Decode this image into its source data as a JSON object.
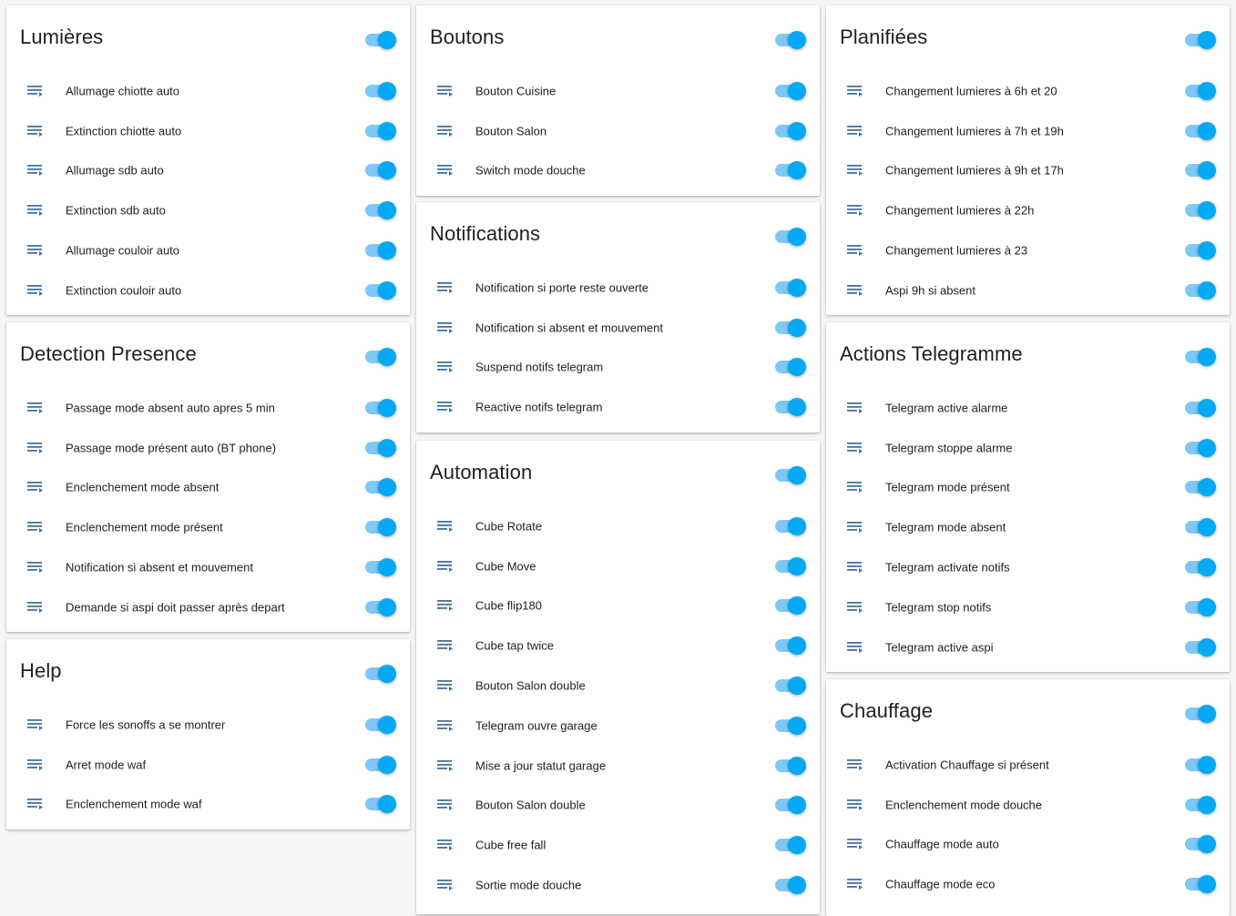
{
  "theme": {
    "accent": "#03a9f4",
    "track": "#7ec8f7",
    "icon_color": "#44739e"
  },
  "columns": [
    {
      "cards": [
        {
          "title": "Lumières",
          "enabled": true,
          "items": [
            {
              "label": "Allumage chiotte auto",
              "icon": "script-text-icon",
              "enabled": true
            },
            {
              "label": "Extinction chiotte auto",
              "icon": "script-text-icon",
              "enabled": true
            },
            {
              "label": "Allumage sdb auto",
              "icon": "script-text-icon",
              "enabled": true
            },
            {
              "label": "Extinction sdb auto",
              "icon": "script-text-icon",
              "enabled": true
            },
            {
              "label": "Allumage couloir auto",
              "icon": "script-text-icon",
              "enabled": true
            },
            {
              "label": "Extinction couloir auto",
              "icon": "script-text-icon",
              "enabled": true
            }
          ]
        },
        {
          "title": "Detection Presence",
          "enabled": true,
          "items": [
            {
              "label": "Passage mode absent auto apres 5 min",
              "icon": "script-text-icon",
              "enabled": true
            },
            {
              "label": "Passage mode présent auto (BT phone)",
              "icon": "script-text-icon",
              "enabled": true
            },
            {
              "label": "Enclenchement mode absent",
              "icon": "script-text-icon",
              "enabled": true
            },
            {
              "label": "Enclenchement mode présent",
              "icon": "script-text-icon",
              "enabled": true
            },
            {
              "label": "Notification si absent et mouvement",
              "icon": "script-text-icon",
              "enabled": true
            },
            {
              "label": "Demande si aspi doit passer après depart",
              "icon": "script-text-icon",
              "enabled": true
            }
          ]
        },
        {
          "title": "Help",
          "enabled": true,
          "items": [
            {
              "label": "Force les sonoffs a se montrer",
              "icon": "script-text-icon",
              "enabled": true
            },
            {
              "label": "Arret mode waf",
              "icon": "script-text-icon",
              "enabled": true
            },
            {
              "label": "Enclenchement mode waf",
              "icon": "script-text-icon",
              "enabled": true
            }
          ]
        }
      ]
    },
    {
      "cards": [
        {
          "title": "Boutons",
          "enabled": true,
          "items": [
            {
              "label": "Bouton Cuisine",
              "icon": "script-text-icon",
              "enabled": true
            },
            {
              "label": "Bouton Salon",
              "icon": "script-text-icon",
              "enabled": true
            },
            {
              "label": "Switch mode douche",
              "icon": "script-text-icon",
              "enabled": true
            }
          ]
        },
        {
          "title": "Notifications",
          "enabled": true,
          "items": [
            {
              "label": "Notification si porte reste ouverte",
              "icon": "script-text-icon",
              "enabled": true
            },
            {
              "label": "Notification si absent et mouvement",
              "icon": "script-text-icon",
              "enabled": true
            },
            {
              "label": "Suspend notifs telegram",
              "icon": "script-text-icon",
              "enabled": true
            },
            {
              "label": "Reactive notifs telegram",
              "icon": "script-text-icon",
              "enabled": true
            }
          ]
        },
        {
          "title": "Automation",
          "enabled": true,
          "items": [
            {
              "label": "Cube Rotate",
              "icon": "script-text-icon",
              "enabled": true
            },
            {
              "label": "Cube Move",
              "icon": "script-text-icon",
              "enabled": true
            },
            {
              "label": "Cube flip180",
              "icon": "script-text-icon",
              "enabled": true
            },
            {
              "label": "Cube tap twice",
              "icon": "script-text-icon",
              "enabled": true
            },
            {
              "label": "Bouton Salon double",
              "icon": "script-text-icon",
              "enabled": true
            },
            {
              "label": "Telegram ouvre garage",
              "icon": "script-text-icon",
              "enabled": true
            },
            {
              "label": "Mise a jour statut garage",
              "icon": "script-text-icon",
              "enabled": true
            },
            {
              "label": "Bouton Salon double",
              "icon": "script-text-icon",
              "enabled": true
            },
            {
              "label": "Cube free fall",
              "icon": "script-text-icon",
              "enabled": true
            },
            {
              "label": "Sortie mode douche",
              "icon": "script-text-icon",
              "enabled": true
            }
          ]
        }
      ]
    },
    {
      "cards": [
        {
          "title": "Planifiées",
          "enabled": true,
          "items": [
            {
              "label": "Changement lumieres à 6h et 20",
              "icon": "script-text-icon",
              "enabled": true
            },
            {
              "label": "Changement lumieres à 7h et 19h",
              "icon": "script-text-icon",
              "enabled": true
            },
            {
              "label": "Changement lumieres à 9h et 17h",
              "icon": "script-text-icon",
              "enabled": true
            },
            {
              "label": "Changement lumieres à 22h",
              "icon": "script-text-icon",
              "enabled": true
            },
            {
              "label": "Changement lumieres à 23",
              "icon": "script-text-icon",
              "enabled": true
            },
            {
              "label": "Aspi 9h si absent",
              "icon": "script-text-icon",
              "enabled": true
            }
          ]
        },
        {
          "title": "Actions Telegramme",
          "enabled": true,
          "items": [
            {
              "label": "Telegram active alarme",
              "icon": "script-text-icon",
              "enabled": true
            },
            {
              "label": "Telegram stoppe alarme",
              "icon": "script-text-icon",
              "enabled": true
            },
            {
              "label": "Telegram mode présent",
              "icon": "script-text-icon",
              "enabled": true
            },
            {
              "label": "Telegram mode absent",
              "icon": "script-text-icon",
              "enabled": true
            },
            {
              "label": "Telegram activate notifs",
              "icon": "script-text-icon",
              "enabled": true
            },
            {
              "label": "Telegram stop notifs",
              "icon": "script-text-icon",
              "enabled": true
            },
            {
              "label": "Telegram active aspi",
              "icon": "script-text-icon",
              "enabled": true
            }
          ]
        },
        {
          "title": "Chauffage",
          "enabled": true,
          "items": [
            {
              "label": "Activation Chauffage si présent",
              "icon": "script-text-icon",
              "enabled": true
            },
            {
              "label": "Enclenchement mode douche",
              "icon": "script-text-icon",
              "enabled": true
            },
            {
              "label": "Chauffage mode auto",
              "icon": "script-text-icon",
              "enabled": true
            },
            {
              "label": "Chauffage mode eco",
              "icon": "script-text-icon",
              "enabled": true
            }
          ]
        }
      ]
    }
  ]
}
